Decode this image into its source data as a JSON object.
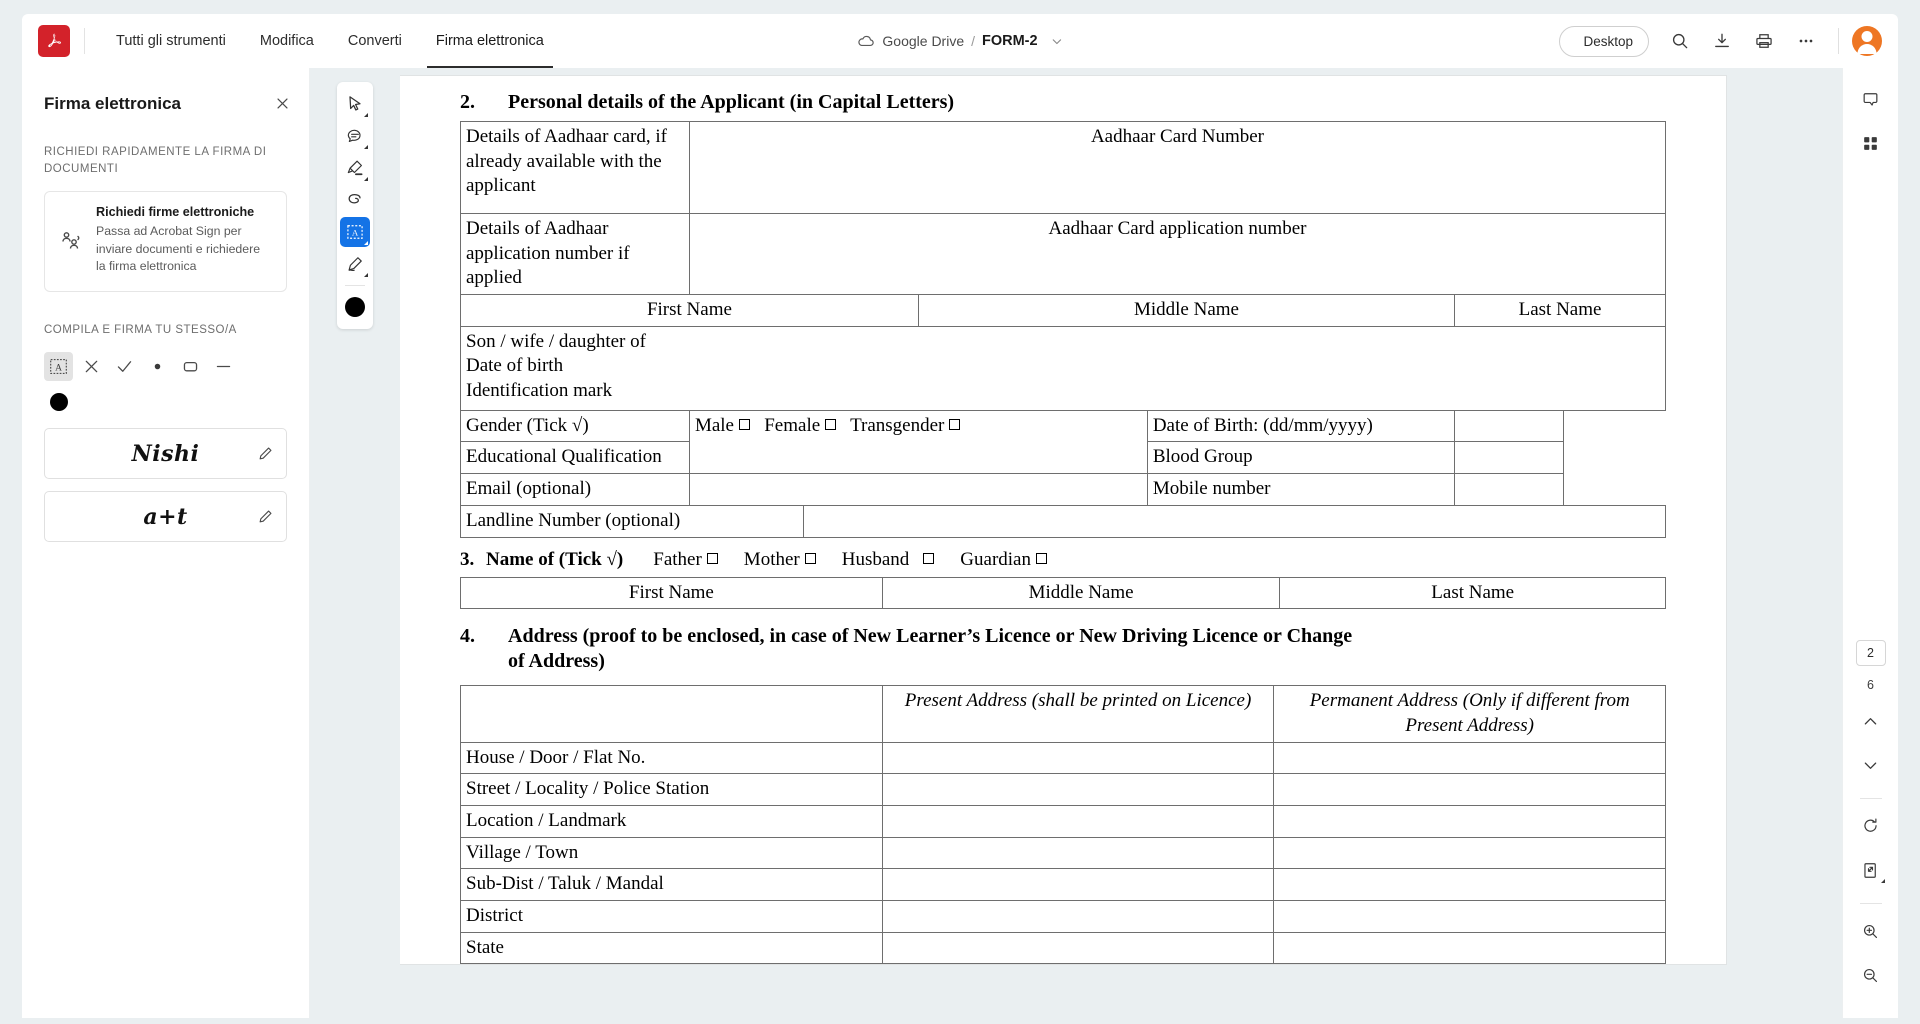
{
  "app": {
    "logo_icon": "acrobat-logo-icon",
    "nav_tabs": [
      {
        "label": "Tutti gli strumenti",
        "active": false
      },
      {
        "label": "Modifica",
        "active": false
      },
      {
        "label": "Converti",
        "active": false
      },
      {
        "label": "Firma elettronica",
        "active": true
      }
    ],
    "breadcrumb": {
      "cloud_icon": "cloud-icon",
      "location": "Google Drive",
      "separator": "/",
      "filename": "FORM-2",
      "chevron_icon": "chevron-down-icon"
    },
    "topright": {
      "desktop_label": "Desktop",
      "desktop_icon": "external-link-icon",
      "search_icon": "search-icon",
      "download_icon": "download-icon",
      "print_icon": "print-icon",
      "more_icon": "more-horizontal-icon",
      "avatar": "user-avatar"
    }
  },
  "left_panel": {
    "title": "Firma elettronica",
    "close_icon": "close-icon",
    "section1_label": "RICHIEDI RAPIDAMENTE LA FIRMA DI DOCUMENTI",
    "card": {
      "icon": "request-signature-icon",
      "title": "Richiedi firme elettroniche",
      "description": "Passa ad Acrobat Sign per inviare documenti e richiedere la firma elettronica"
    },
    "section2_label": "COMPILA E FIRMA TU STESSO/A",
    "tools": [
      {
        "name": "add-text-icon",
        "selected": true
      },
      {
        "name": "cross-mark-icon",
        "selected": false
      },
      {
        "name": "check-mark-icon",
        "selected": false
      },
      {
        "name": "dot-icon",
        "selected": false
      },
      {
        "name": "rounded-rect-icon",
        "selected": false
      },
      {
        "name": "line-icon",
        "selected": false
      }
    ],
    "color_swatch": "#000000",
    "signatures": [
      {
        "text": "Nishi",
        "edit_icon": "pencil-icon"
      },
      {
        "text": "a+t",
        "edit_icon": "pencil-icon"
      }
    ]
  },
  "toolstrip": [
    {
      "name": "select-cursor-icon",
      "active": false,
      "caret": true
    },
    {
      "name": "comment-icon",
      "active": false,
      "caret": true
    },
    {
      "name": "highlighter-icon",
      "active": false,
      "caret": true
    },
    {
      "name": "squiggly-draw-icon",
      "active": false,
      "caret": false
    },
    {
      "name": "fill-and-sign-icon",
      "active": true,
      "caret": true
    },
    {
      "name": "sign-pen-icon",
      "active": false,
      "caret": true
    },
    {
      "name": "color-black-dot",
      "active": false,
      "caret": false
    }
  ],
  "right_rail": {
    "top": [
      {
        "name": "comment-panel-icon"
      },
      {
        "name": "all-tools-grid-icon"
      }
    ],
    "page_current": "2",
    "page_total": "6",
    "prev_icon": "chevron-up-icon",
    "next_icon": "chevron-down-icon",
    "rotate_icon": "rotate-clockwise-icon",
    "fit_page_icon": "fit-page-icon",
    "zoom_in_icon": "zoom-in-icon",
    "zoom_out_icon": "zoom-out-icon"
  },
  "document": {
    "section2": {
      "number": "2.",
      "title": "Personal details of the Applicant (in Capital Letters)",
      "rows": {
        "aadhaar_label": "Details of Aadhaar card, if already available with the applicant",
        "aadhaar_value": "Aadhaar Card Number",
        "aadhaar_app_label": "Details of Aadhaar application number if applied",
        "aadhaar_app_value": "Aadhaar Card application number",
        "first_name": "First Name",
        "middle_name": "Middle Name",
        "last_name": "Last Name",
        "relation_line1": "Son / wife / daughter of",
        "relation_line2": "Date of birth",
        "relation_line3": "Identification mark",
        "gender_label": "Gender (Tick √)",
        "gender_male": "Male",
        "gender_female": "Female",
        "gender_transgender": "Transgender",
        "dob_label": "Date of Birth: (dd/mm/yyyy)",
        "education_label": "Educational Qualification",
        "blood_group_label": "Blood Group",
        "email_label": "Email (optional)",
        "mobile_label": "Mobile number",
        "landline_label": "Landline Number (optional)"
      }
    },
    "section3": {
      "number": "3.",
      "title": "Name of (Tick √)",
      "options": [
        "Father",
        "Mother",
        "Husband",
        "Guardian"
      ],
      "columns": [
        "First Name",
        "Middle Name",
        "Last Name"
      ]
    },
    "section4": {
      "number": "4.",
      "title": "Address (proof to be enclosed, in case of New Learner’s Licence or New Driving Licence or Change of Address)",
      "col_present": "Present Address (shall be printed on Licence)",
      "col_permanent": "Permanent Address (Only if different from Present Address)",
      "rows": [
        "House / Door / Flat No.",
        "Street / Locality / Police Station",
        "Location / Landmark",
        "Village / Town",
        "Sub-Dist / Taluk / Mandal",
        "District",
        "State"
      ]
    }
  }
}
